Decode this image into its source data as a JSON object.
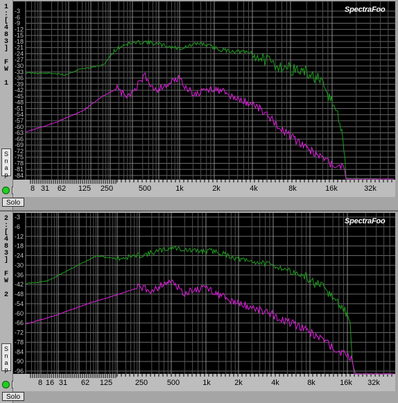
{
  "panels": [
    {
      "id": 1,
      "side_label": "1:[483] FW 1",
      "logo": "SpectraFoo",
      "snap_label": "Snap",
      "solo_label": "Solo",
      "y_ticks": [
        "-3",
        "-6",
        "-9",
        "-12",
        "-15",
        "-18",
        "-21",
        "-24",
        "-27",
        "-30",
        "-33",
        "-36",
        "-39",
        "-42",
        "-45",
        "-48",
        "-51",
        "-54",
        "-57",
        "-60",
        "-63",
        "-66",
        "-69",
        "-72",
        "-75",
        "-78",
        "-81",
        "-84"
      ],
      "x_ticks": [
        "8",
        "31",
        "62",
        "125",
        "250",
        "500",
        "1k",
        "2k",
        "4k",
        "8k",
        "16k",
        "32k"
      ]
    },
    {
      "id": 2,
      "side_label": "2:[483] FW 2",
      "logo": "SpectraFoo",
      "snap_label": "Snap",
      "solo_label": "Solo",
      "y_ticks": [
        "-3",
        "-6",
        "-12",
        "-18",
        "-24",
        "-30",
        "-36",
        "-42",
        "-48",
        "-54",
        "-60",
        "-66",
        "-72",
        "-78",
        "-84",
        "-90",
        "-96"
      ],
      "x_ticks": [
        "8",
        "16",
        "31",
        "62",
        "125",
        "250",
        "500",
        "1k",
        "2k",
        "4k",
        "8k",
        "16k",
        "32k"
      ]
    }
  ],
  "colors": {
    "green": "#1f9e1f",
    "magenta": "#e020e0",
    "grid": "#9a9a9a",
    "plot_bg": "#000000"
  }
}
